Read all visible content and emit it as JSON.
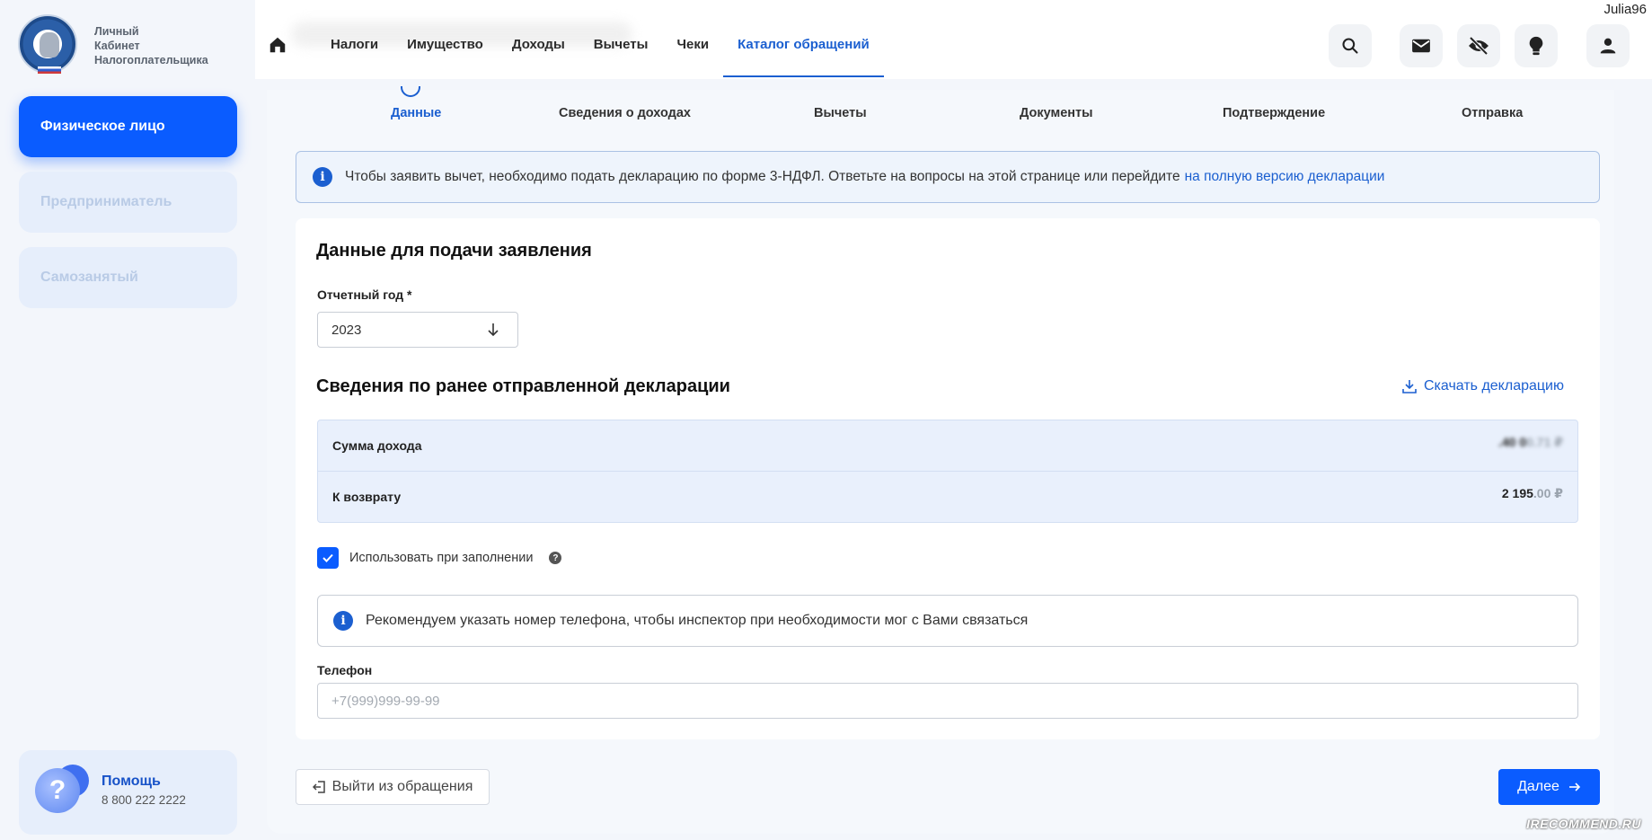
{
  "app": {
    "brand_lines": [
      "Личный",
      "Кабинет",
      "Налогоплательщика"
    ],
    "user_name": "Julia96",
    "watermark": "IRECOMMEND.RU"
  },
  "sidebar": {
    "items": [
      {
        "label": "Физическое лицо",
        "active": true
      },
      {
        "label": "Предприниматель",
        "active": false
      },
      {
        "label": "Самозанятый",
        "active": false
      }
    ],
    "help": {
      "title": "Помощь",
      "phone": "8 800 222 2222",
      "icon": "?"
    }
  },
  "nav": {
    "items": [
      "Налоги",
      "Имущество",
      "Доходы",
      "Вычеты",
      "Чеки",
      "Каталог обращений"
    ],
    "active_index": 5,
    "icons": [
      "search-icon",
      "mail-icon",
      "eye-off-icon",
      "lightbulb-icon",
      "user-icon"
    ]
  },
  "steps": {
    "items": [
      "Данные",
      "Сведения о доходах",
      "Вычеты",
      "Документы",
      "Подтверждение",
      "Отправка"
    ],
    "active_index": 0
  },
  "info_banner": {
    "icon": "i",
    "text": "Чтобы заявить вычет, необходимо подать декларацию по форме 3-НДФЛ. Ответьте на вопросы на этой странице или перейдите",
    "link": "на полную версию декларации"
  },
  "form": {
    "title": "Данные для подачи заявления",
    "year_label": "Отчетный год *",
    "year_value": "2023",
    "prev_title": "Сведения по ранее отправленной декларации",
    "download_label": "Скачать декларацию",
    "summary": [
      {
        "label": "Сумма дохода",
        "value": ".40 0",
        "decimals": "0.71 ₽"
      },
      {
        "label": "К возврату",
        "value": "2 195",
        "decimals": ".00 ₽"
      }
    ],
    "use_label": "Использовать при заполнении",
    "use_checked": true,
    "recommend_icon": "i",
    "recommend_text": "Рекомендуем указать номер телефона, чтобы инспектор при необходимости мог с Вами связаться",
    "phone_label": "Телефон",
    "phone_placeholder": "+7(999)999-99-99",
    "phone_value": ""
  },
  "footer": {
    "exit_label": "Выйти из обращения",
    "next_label": "Далее"
  },
  "colors": {
    "accent": "#0a5cff",
    "link": "#1b5fd0",
    "sidebar_inactive": "#e6eefb"
  }
}
